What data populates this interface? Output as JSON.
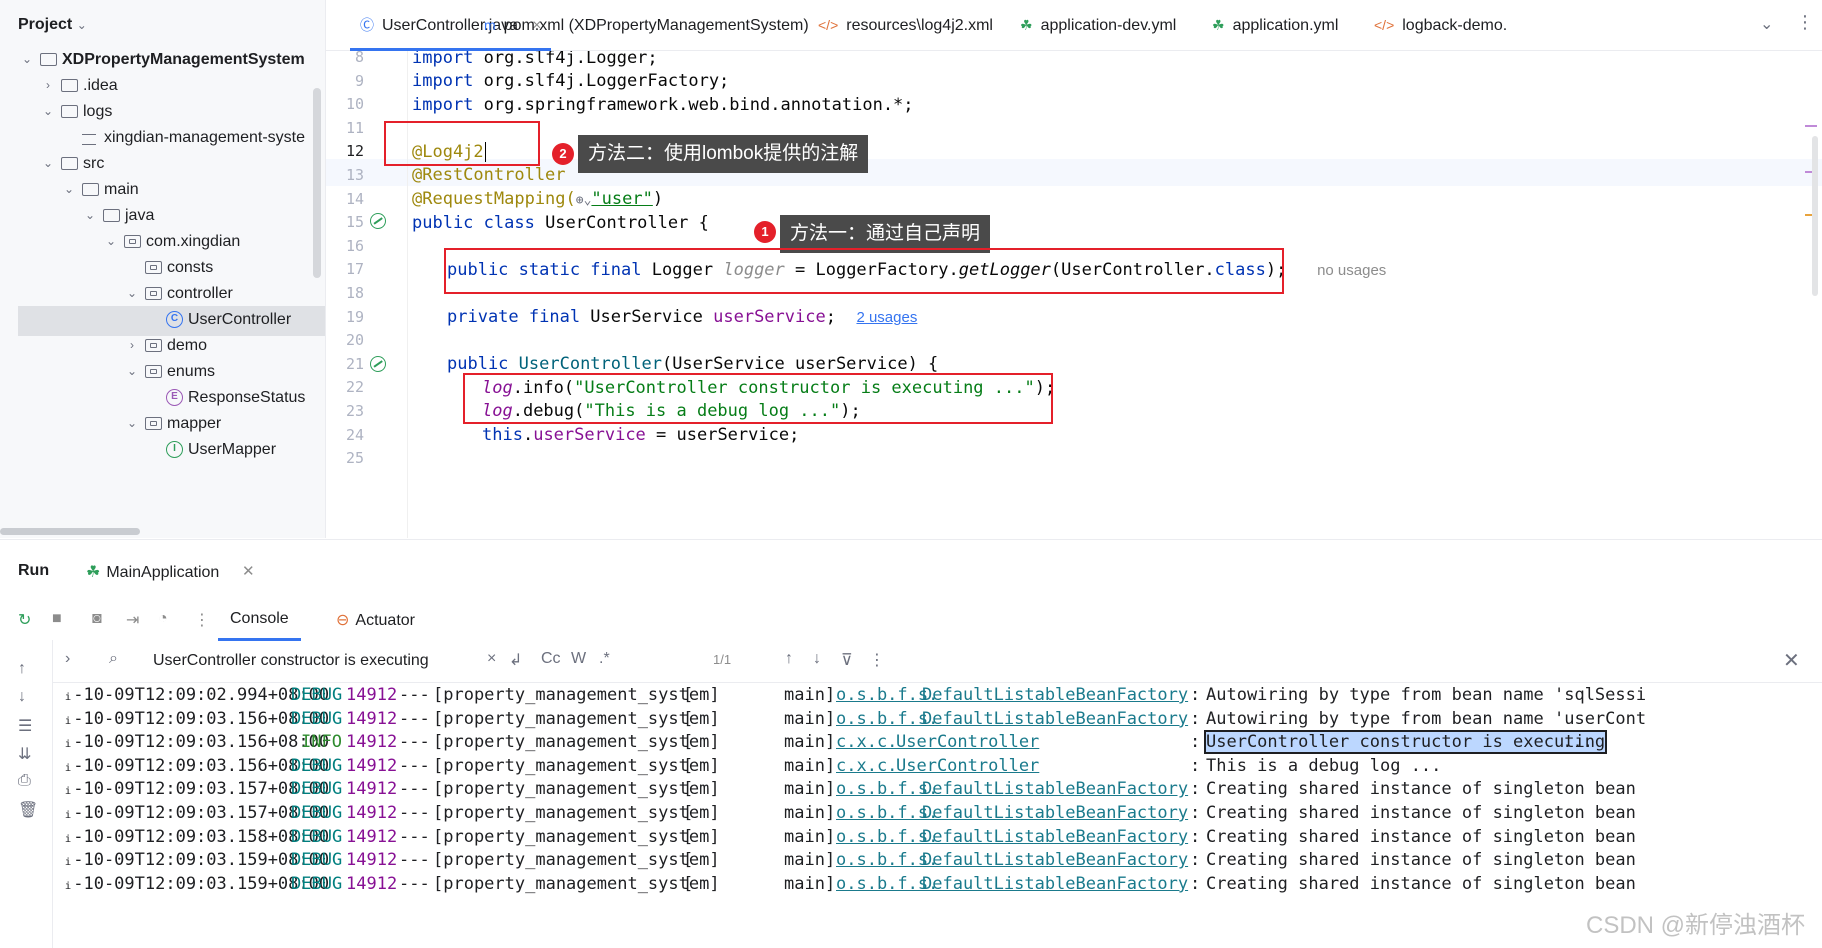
{
  "project": {
    "header": "Project",
    "tree": [
      {
        "label": "XDPropertyManagementSystem",
        "bold": true,
        "kind": "module",
        "indent": 0,
        "chev": "open"
      },
      {
        "label": ".idea",
        "kind": "folder",
        "indent": 1,
        "chev": "closed"
      },
      {
        "label": "logs",
        "kind": "folder",
        "indent": 1,
        "chev": "open"
      },
      {
        "label": "xingdian-management-syste",
        "kind": "log",
        "indent": 2,
        "chev": ""
      },
      {
        "label": "src",
        "kind": "folder",
        "indent": 1,
        "chev": "open"
      },
      {
        "label": "main",
        "kind": "folder",
        "indent": 2,
        "chev": "open"
      },
      {
        "label": "java",
        "kind": "folder",
        "indent": 3,
        "chev": "open"
      },
      {
        "label": "com.xingdian",
        "kind": "pkg",
        "indent": 4,
        "chev": "open"
      },
      {
        "label": "consts",
        "kind": "pkg",
        "indent": 5,
        "chev": ""
      },
      {
        "label": "controller",
        "kind": "pkg",
        "indent": 5,
        "chev": "open"
      },
      {
        "label": "UserController",
        "kind": "class",
        "indent": 6,
        "chev": "",
        "selected": true
      },
      {
        "label": "demo",
        "kind": "pkg",
        "indent": 5,
        "chev": "closed"
      },
      {
        "label": "enums",
        "kind": "pkg",
        "indent": 5,
        "chev": "open"
      },
      {
        "label": "ResponseStatus",
        "kind": "enum",
        "indent": 6,
        "chev": ""
      },
      {
        "label": "mapper",
        "kind": "pkg",
        "indent": 5,
        "chev": "open"
      },
      {
        "label": "UserMapper",
        "kind": "iface",
        "indent": 6,
        "chev": ""
      }
    ]
  },
  "tabs": [
    {
      "label": "UserController.java",
      "icon": "class-icon",
      "glyph": "Ⓒ",
      "color": "#3574f0",
      "active": true,
      "close": "×"
    },
    {
      "label": "pom.xml (XDPropertyManagementSystem)",
      "icon": "maven-icon",
      "glyph": "m",
      "color": "#3574f0"
    },
    {
      "label": "resources\\log4j2.xml",
      "icon": "xml-icon",
      "glyph": "</>",
      "color": "#e0723a"
    },
    {
      "label": "application-dev.yml",
      "icon": "spring-config-icon",
      "glyph": "☘",
      "color": "#2e9e5a"
    },
    {
      "label": "application.yml",
      "icon": "spring-config-icon",
      "glyph": "☘",
      "color": "#2e9e5a"
    },
    {
      "label": "logback-demo.",
      "icon": "xml-icon",
      "glyph": "</>",
      "color": "#e0723a"
    }
  ],
  "editor": {
    "warnings": "1",
    "current_line": "12",
    "lines": [
      {
        "n": "8"
      },
      {
        "n": "9"
      },
      {
        "n": "10"
      },
      {
        "n": "11"
      },
      {
        "n": "12"
      },
      {
        "n": "13"
      },
      {
        "n": "14"
      },
      {
        "n": "15"
      },
      {
        "n": "16"
      },
      {
        "n": "17"
      },
      {
        "n": "18"
      },
      {
        "n": "19"
      },
      {
        "n": "20"
      },
      {
        "n": "21"
      },
      {
        "n": "22"
      },
      {
        "n": "23"
      },
      {
        "n": "24"
      },
      {
        "n": "25"
      }
    ],
    "code": {
      "l8_kw": "import",
      "l8_rest": " org.slf4j.Logger;",
      "l9_kw": "import",
      "l9_rest": " org.slf4j.LoggerFactory;",
      "l10_kw": "import",
      "l10_rest": " org.springframework.web.bind.annotation.*;",
      "l12": "@Log4j2",
      "l13": "@RestController",
      "l14_ann": "@RequestMapping(",
      "l14_globe": "⊕⌄",
      "l14_str": "\"user\"",
      "l14_end": ")",
      "l15_kw": "public class",
      "l15_rest": " UserController {",
      "l17_kw": "public static final",
      "l17_type": " Logger ",
      "l17_fld": "logger",
      "l17_mid": " = LoggerFactory.",
      "l17_call": "getLogger",
      "l17_arg": "(UserController.",
      "l17_cls": "class",
      "l17_end": ");",
      "l17_hint": "no usages",
      "l19_kw": "private final",
      "l19_type": " UserService ",
      "l19_fld": "userService",
      "l19_end": ";",
      "l19_link": "2 usages",
      "l21_kw": "public",
      "l21_name": " UserController",
      "l21_rest": "(UserService userService) {",
      "l22_log": "log",
      "l22_mid": ".info(",
      "l22_str": "\"UserController constructor is executing ...\"",
      "l22_end": ");",
      "l23_log": "log",
      "l23_mid": ".debug(",
      "l23_str": "\"This is a debug log ...\"",
      "l23_end": ");",
      "l24_kw": "this",
      "l24_dot": ".",
      "l24_fld": "userService",
      "l24_rest": " = userService;"
    },
    "callouts": [
      {
        "badge": "2",
        "text": "方法二：使用lombok提供的注解"
      },
      {
        "badge": "1",
        "text": "方法一：通过自己声明"
      }
    ]
  },
  "run": {
    "title": "Run",
    "config": "MainApplication",
    "tab_console": "Console",
    "tab_actuator": "Actuator",
    "search_value": "UserController constructor is executing",
    "search_opts": [
      "Cc",
      "W",
      ".*"
    ],
    "match_count": "1/1",
    "log": [
      {
        "ts": "ᵢ-10-09T12:09:02.994+08:00",
        "lvl": "DEBUG",
        "pid": "14912",
        "sep": "---",
        "app": "[property_management_system]",
        "br": "[",
        "thr": "main]",
        "pkg": "o.s.b.f.s.",
        "cls": "DefaultListableBeanFactory",
        "colon": ":",
        "msg": "Autowiring by type from bean name 'sqlSessi"
      },
      {
        "ts": "ᵢ-10-09T12:09:03.156+08:00",
        "lvl": "DEBUG",
        "pid": "14912",
        "sep": "---",
        "app": "[property_management_system]",
        "br": "[",
        "thr": "main]",
        "pkg": "o.s.b.f.s.",
        "cls": "DefaultListableBeanFactory",
        "colon": ":",
        "msg": "Autowiring by type from bean name 'userCont"
      },
      {
        "ts": "ᵢ-10-09T12:09:03.156+08:00",
        "lvl": "INFO",
        "pid": "14912",
        "sep": "---",
        "app": "[property_management_system]",
        "br": "[",
        "thr": "main]",
        "pkg": "c.x.c.",
        "cls": "UserController",
        "colon": ":",
        "msg": "UserController constructor is executing",
        "tail": " ...",
        "hl": true
      },
      {
        "ts": "ᵢ-10-09T12:09:03.156+08:00",
        "lvl": "DEBUG",
        "pid": "14912",
        "sep": "---",
        "app": "[property_management_system]",
        "br": "[",
        "thr": "main]",
        "pkg": "c.x.c.",
        "cls": "UserController",
        "colon": ":",
        "msg": "This is a debug log ..."
      },
      {
        "ts": "ᵢ-10-09T12:09:03.157+08:00",
        "lvl": "DEBUG",
        "pid": "14912",
        "sep": "---",
        "app": "[property_management_system]",
        "br": "[",
        "thr": "main]",
        "pkg": "o.s.b.f.s.",
        "cls": "DefaultListableBeanFactory",
        "colon": ":",
        "msg": "Creating shared instance of singleton bean"
      },
      {
        "ts": "ᵢ-10-09T12:09:03.157+08:00",
        "lvl": "DEBUG",
        "pid": "14912",
        "sep": "---",
        "app": "[property_management_system]",
        "br": "[",
        "thr": "main]",
        "pkg": "o.s.b.f.s.",
        "cls": "DefaultListableBeanFactory",
        "colon": ":",
        "msg": "Creating shared instance of singleton bean"
      },
      {
        "ts": "ᵢ-10-09T12:09:03.158+08:00",
        "lvl": "DEBUG",
        "pid": "14912",
        "sep": "---",
        "app": "[property_management_system]",
        "br": "[",
        "thr": "main]",
        "pkg": "o.s.b.f.s.",
        "cls": "DefaultListableBeanFactory",
        "colon": ":",
        "msg": "Creating shared instance of singleton bean"
      },
      {
        "ts": "ᵢ-10-09T12:09:03.159+08:00",
        "lvl": "DEBUG",
        "pid": "14912",
        "sep": "---",
        "app": "[property_management_system]",
        "br": "[",
        "thr": "main]",
        "pkg": "o.s.b.f.s.",
        "cls": "DefaultListableBeanFactory",
        "colon": ":",
        "msg": "Creating shared instance of singleton bean"
      },
      {
        "ts": "ᵢ-10-09T12:09:03.159+08:00",
        "lvl": "DEBUG",
        "pid": "14912",
        "sep": "---",
        "app": "[property_management_system]",
        "br": "[",
        "thr": "main]",
        "pkg": "o.s.b.f.s.",
        "cls": "DefaultListableBeanFactory",
        "colon": ":",
        "msg": "Creating shared instance of singleton bean"
      }
    ]
  },
  "watermark": "CSDN @新停浊酒杯",
  "colors": {
    "accent": "#3574f0",
    "annotation_box": "#e4202a",
    "callout_bg": "#4a4a4a"
  }
}
